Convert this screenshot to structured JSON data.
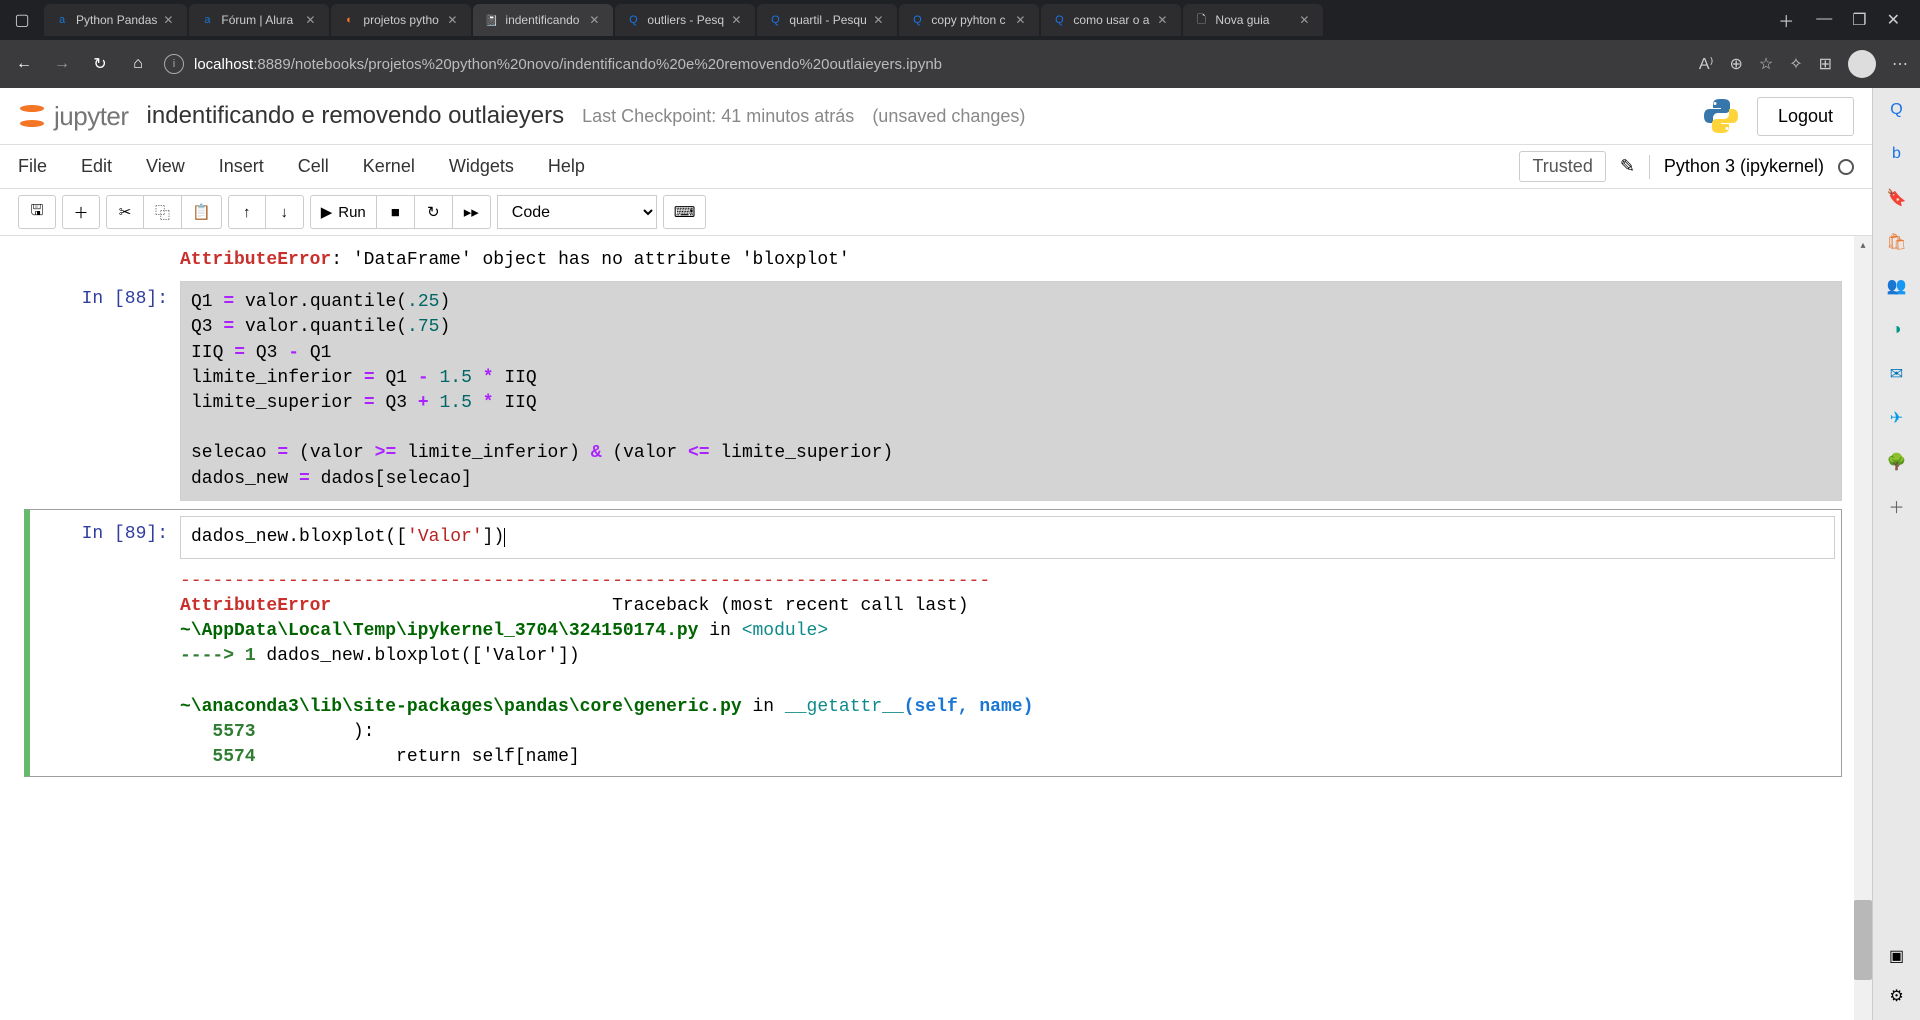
{
  "browser": {
    "tabs": [
      {
        "favicon": "a",
        "favcolor": "#1976d2",
        "label": "Python Pandas"
      },
      {
        "favicon": "a",
        "favcolor": "#1976d2",
        "label": "Fórum | Alura"
      },
      {
        "favicon": "◐",
        "favcolor": "#f37626",
        "label": "projetos pytho"
      },
      {
        "favicon": "📓",
        "favcolor": "#f37626",
        "label": "indentificando",
        "active": true
      },
      {
        "favicon": "Q",
        "favcolor": "#1a73e8",
        "label": "outliers - Pesq"
      },
      {
        "favicon": "Q",
        "favcolor": "#1a73e8",
        "label": "quartil - Pesqu"
      },
      {
        "favicon": "Q",
        "favcolor": "#1a73e8",
        "label": "copy pyhton c"
      },
      {
        "favicon": "Q",
        "favcolor": "#1a73e8",
        "label": "como usar o a"
      },
      {
        "favicon": "🗋",
        "favcolor": "#ccc",
        "label": "Nova guia"
      }
    ],
    "url_host": "localhost",
    "url_path": ":8889/notebooks/projetos%20python%20novo/indentificando%20e%20removendo%20outlaieyers.ipynb"
  },
  "jupyter": {
    "logo_text": "jupyter",
    "title": "indentificando e removendo outlaieyers",
    "checkpoint": "Last Checkpoint: 41 minutos atrás",
    "unsaved": "(unsaved changes)",
    "logout": "Logout",
    "menu": [
      "File",
      "Edit",
      "View",
      "Insert",
      "Cell",
      "Kernel",
      "Widgets",
      "Help"
    ],
    "trusted": "Trusted",
    "kernel": "Python 3 (ipykernel)",
    "toolbar": {
      "run": "Run",
      "cell_type": "Code"
    }
  },
  "cells": {
    "error_top": {
      "name": "AttributeError",
      "msg": ": 'DataFrame' object has no attribute 'bloxplot'"
    },
    "c88": {
      "prompt": "In [88]:",
      "code": "Q1 = valor.quantile(.25)\nQ3 = valor.quantile(.75)\nIIQ = Q3 - Q1\nlimite_inferior = Q1 - 1.5 * IIQ\nlimite_superior = Q3 + 1.5 * IIQ\n\nselecao = (valor >= limite_inferior) & (valor <= limite_superior)\ndados_new = dados[selecao]"
    },
    "c89": {
      "prompt": "In [89]:",
      "code_prefix": "dados_new.bloxplot([",
      "code_str": "'Valor'",
      "code_suffix": "])",
      "tb_dashes": "---------------------------------------------------------------------------",
      "tb_name": "AttributeError",
      "tb_trace": "                          Traceback (most recent call last)",
      "tb_file1": "~\\AppData\\Local\\Temp\\ipykernel_3704\\324150174.py",
      "tb_in": " in ",
      "tb_module": "<module>",
      "tb_arrow": "----> ",
      "tb_arrow_num": "1",
      "tb_arrow_code": " dados_new.bloxplot(['Valor'])",
      "tb_file2": "~\\anaconda3\\lib\\site-packages\\pandas\\core\\generic.py",
      "tb_getattr": "__getattr__",
      "tb_sig": "(self, name)",
      "tb_line1_num": "5573",
      "tb_line1_code": "         ):",
      "tb_line2_num": "5574",
      "tb_line2_code": "             return self[name]"
    }
  }
}
